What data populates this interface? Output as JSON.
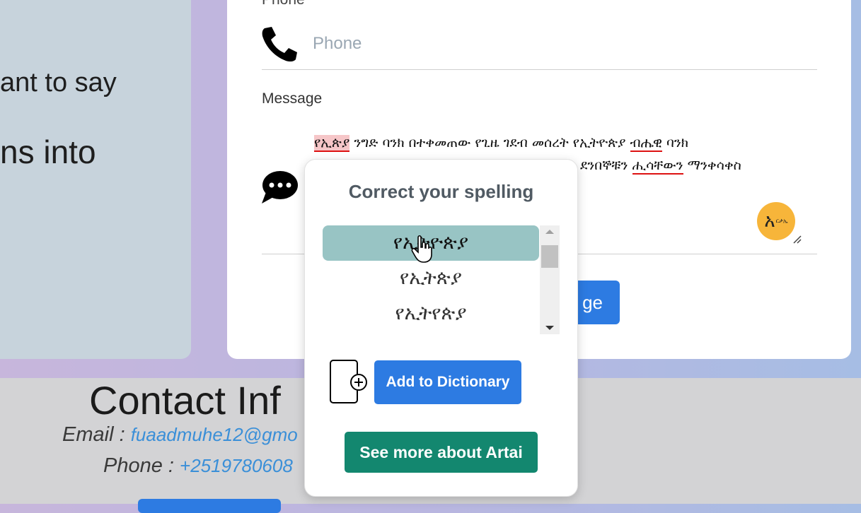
{
  "left_card": {
    "line1": "ant to say",
    "line2": "ns into"
  },
  "form": {
    "phone_title": "Phone",
    "phone_placeholder": "Phone",
    "message_label": "Message",
    "message_line1": {
      "w1": "የኢጵያ",
      "w2": " ንግድ ባንክ በተቀመጠው የጊዜ ገደብ መሰረት የኢትዮጵያ ",
      "w3": "ብሔዊ",
      "w4": " ባንክ"
    },
    "message_line2": {
      "w1": "ደንበኞቹን ",
      "w2": "ሒሳቸውን",
      "w3": " ማንቀሳቀስ"
    },
    "artai_badge": {
      "glyph": "አ",
      "small": "ርታኢ"
    },
    "send_label": "ge"
  },
  "popup": {
    "title": "Correct your spelling",
    "suggestions": [
      "የኢትዮጵያ",
      "የኢትጵያ",
      "የኢትየጵያ"
    ],
    "add_dictionary_label": "Add to Dictionary",
    "see_more_label": "See more about Artai"
  },
  "contact": {
    "title": "Contact Inf",
    "email_label": "Email : ",
    "email_value": "fuaadmuhe12@gmo",
    "phone_label": "Phone : ",
    "phone_value": "+2519780608"
  },
  "colors": {
    "accent_blue": "#2d7be2",
    "selected_suggestion": "#98c4c4",
    "see_more_green": "#13876f",
    "error_red": "#d11111",
    "badge_orange": "#f7b53a"
  }
}
